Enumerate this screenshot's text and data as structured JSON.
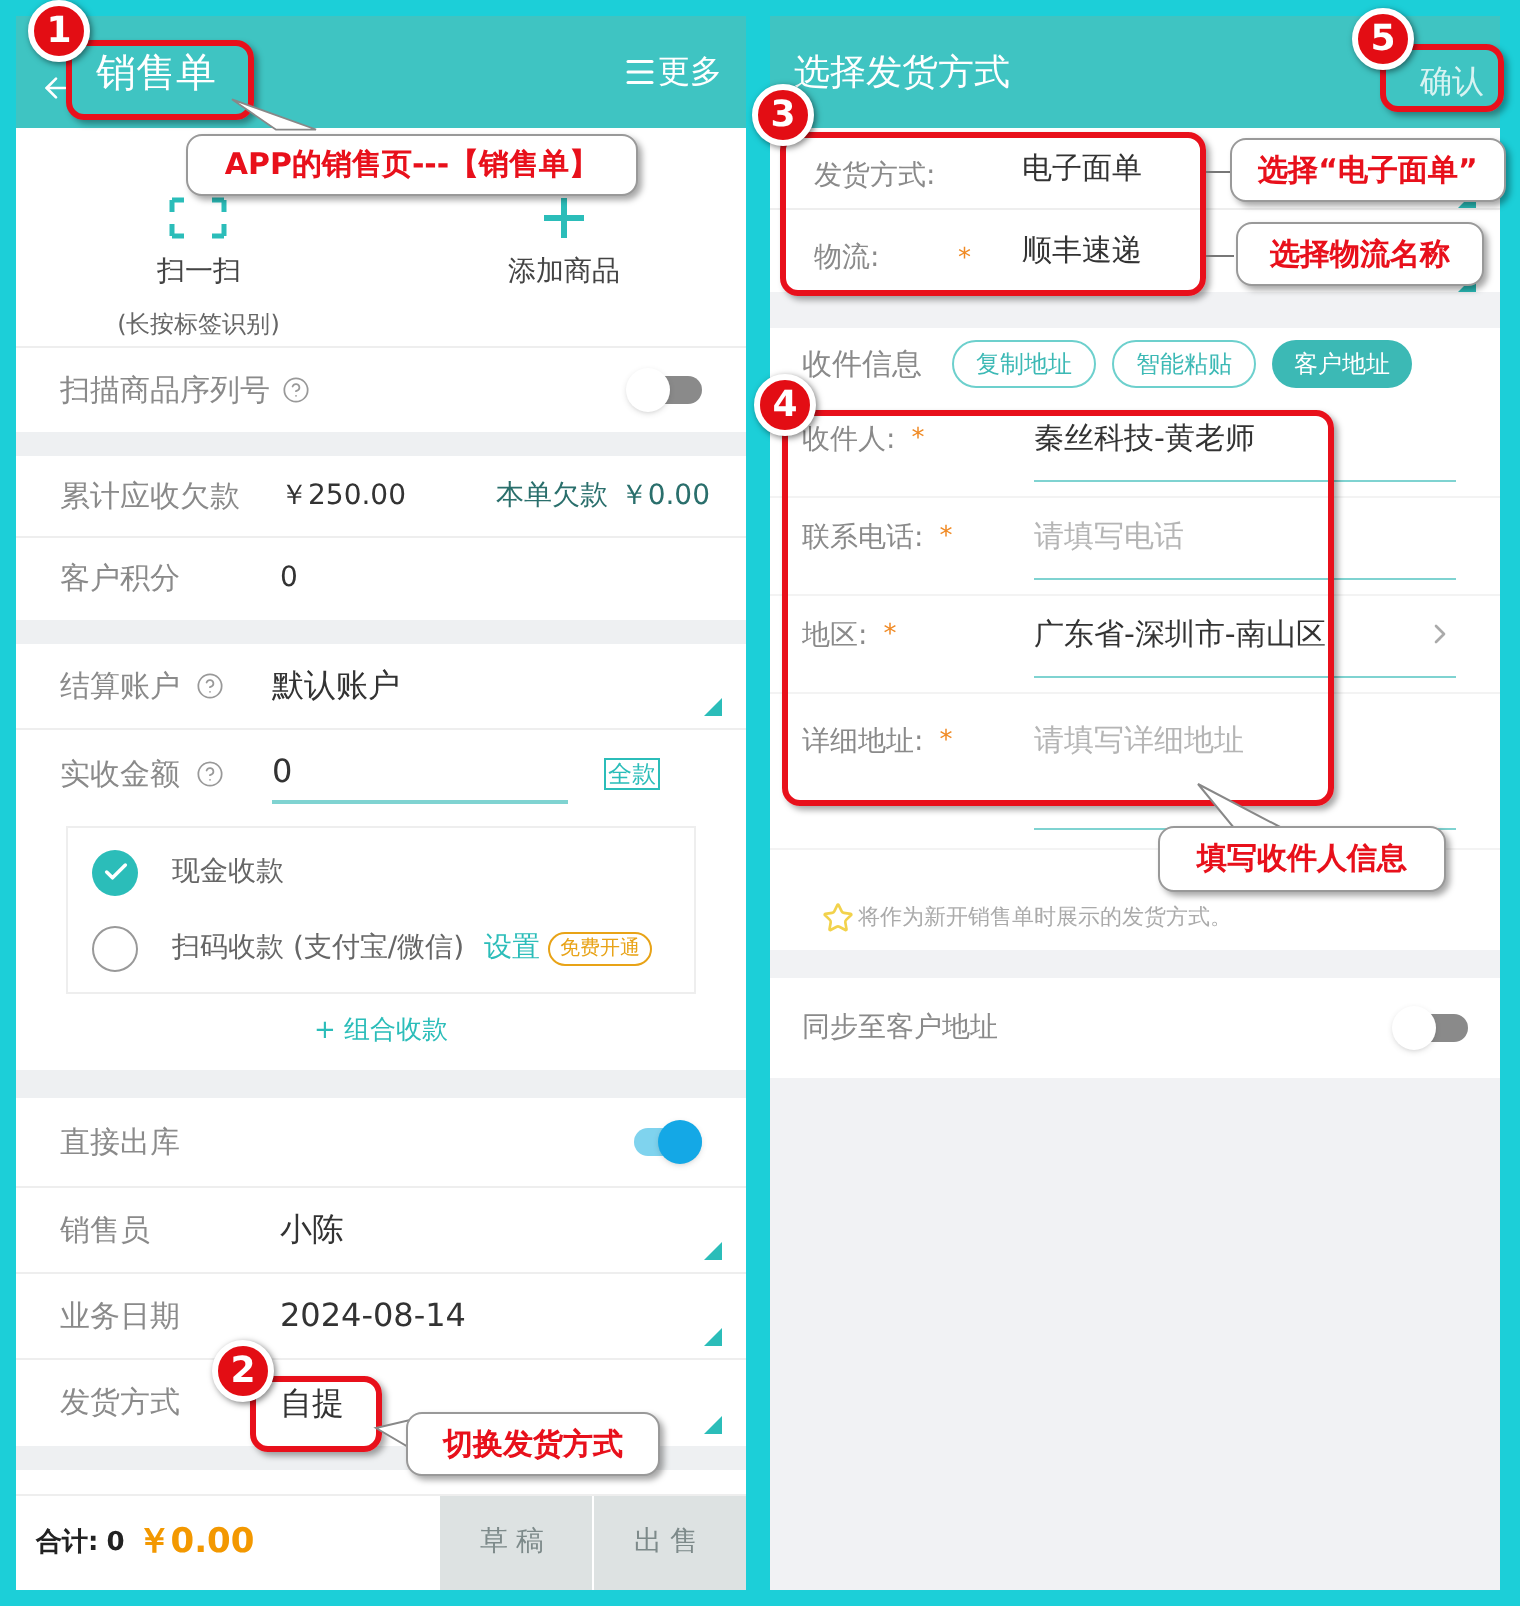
{
  "left": {
    "header": {
      "title": "销售单",
      "more": "更多"
    },
    "quick_actions": [
      {
        "label": "扫一扫",
        "hint": "(长按标签识别)",
        "kind": "scan"
      },
      {
        "label": "添加商品",
        "kind": "add"
      }
    ],
    "serial_scan": {
      "label": "扫描商品序列号",
      "on": false
    },
    "debt": {
      "label": "累计应收欠款",
      "value": "￥250.00",
      "order_label": "本单欠款",
      "order_value": "￥0.00"
    },
    "points": {
      "label": "客户积分",
      "value": "0"
    },
    "account": {
      "label": "结算账户",
      "value": "默认账户"
    },
    "received": {
      "label": "实收金额",
      "value": "0",
      "full_button": "全款"
    },
    "payment_methods": [
      {
        "label": "现金收款",
        "selected": true
      },
      {
        "label": "扫码收款 (支付宝/微信)",
        "selected": false,
        "link": "设置",
        "badge": "免费开通"
      }
    ],
    "combo": "+ 组合收款",
    "direct_out": {
      "label": "直接出库",
      "on": true
    },
    "fields": [
      {
        "label": "销售员",
        "value": "小陈"
      },
      {
        "label": "业务日期",
        "value": "2024-08-14"
      },
      {
        "label": "发货方式",
        "value": "自提"
      }
    ],
    "footer": {
      "total_label": "合计:",
      "count": "0",
      "amount": "￥0.00",
      "buttons": [
        "草稿",
        "出售"
      ]
    }
  },
  "right": {
    "header": {
      "title": "选择发货方式",
      "confirm": "确认"
    },
    "shipping": [
      {
        "label": "发货方式:",
        "value": "电子面单"
      },
      {
        "label": "物流:",
        "required_mark": "*",
        "value": "顺丰速递"
      }
    ],
    "recipient_title": "收件信息",
    "recipient_buttons": [
      {
        "label": "复制地址",
        "selected": false
      },
      {
        "label": "智能粘贴",
        "selected": false
      },
      {
        "label": "客户地址",
        "selected": true
      }
    ],
    "recipient_fields": [
      {
        "label": "收件人:",
        "required_mark": "*",
        "value": "秦丝科技-黄老师",
        "kind": "text"
      },
      {
        "label": "联系电话:",
        "required_mark": "*",
        "placeholder": "请填写电话",
        "kind": "text"
      },
      {
        "label": "地区:",
        "required_mark": "*",
        "value": "广东省-深圳市-南山区",
        "kind": "picker"
      },
      {
        "label": "详细地址:",
        "required_mark": "*",
        "placeholder": "请填写详细地址",
        "kind": "multiline"
      }
    ],
    "default_note": "将作为新开销售单时展示的发货方式。",
    "sync": {
      "label": "同步至客户地址",
      "on": false
    }
  },
  "annotations": {
    "badges": [
      "1",
      "2",
      "3",
      "4",
      "5"
    ],
    "callouts": [
      "APP的销售页---【销售单】",
      "切换发货方式",
      "选择“电子面单”",
      "选择物流名称",
      "填写收件人信息"
    ]
  }
}
